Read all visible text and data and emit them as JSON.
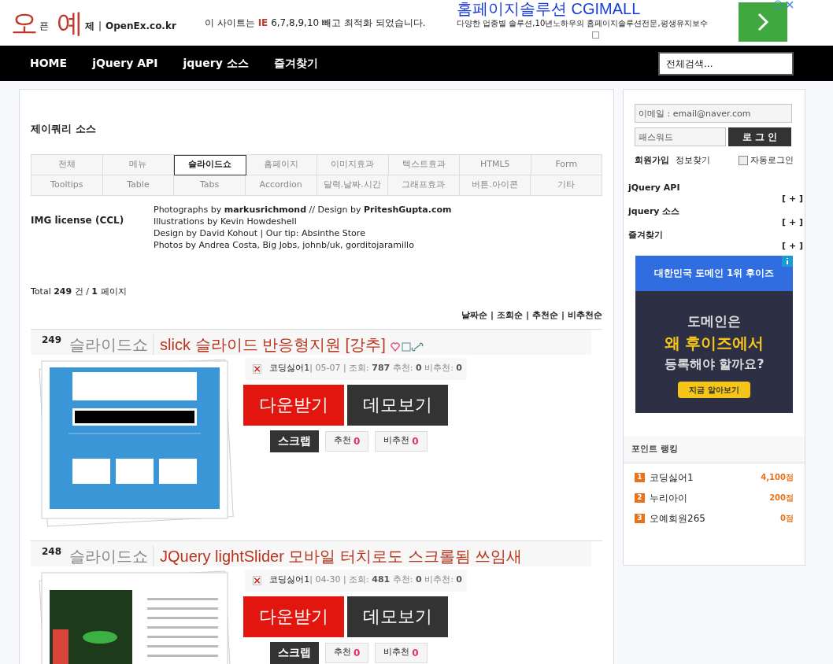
{
  "header": {
    "logo": {
      "big_1": "오",
      "small_1": "픈",
      "big_2": "예",
      "small_2": "제",
      "separator": "|",
      "domain": "OpenEx.co.kr"
    },
    "notice": "이 사이트는 **IE** 6,7,8,9,10 빼고 최적화 되었습니다.",
    "ad": {
      "title": "홈페이지솔루션 CGIMALL",
      "text": "다양한 업종별 솔루션,10년노하우의 홈페이지솔루션전문,평생유지보수",
      "checked": false
    }
  },
  "nav": {
    "items": [
      "HOME",
      "jQuery API",
      "jquery 소스",
      "즐겨찾기"
    ],
    "search": {
      "placeholder": "전체검색..."
    }
  },
  "main": {
    "title": "제이쿼리 소스",
    "categories": [
      {
        "label": "전체",
        "selected": false
      },
      {
        "label": "메뉴",
        "selected": false
      },
      {
        "label": "슬라이드쇼",
        "selected": true
      },
      {
        "label": "홈페이지",
        "selected": false
      },
      {
        "label": "이미지효과",
        "selected": false
      },
      {
        "label": "텍스트효과",
        "selected": false
      },
      {
        "label": "HTML5",
        "selected": false
      },
      {
        "label": "Form",
        "selected": false
      },
      {
        "label": "Tooltips",
        "selected": false
      },
      {
        "label": "Table",
        "selected": false
      },
      {
        "label": "Tabs",
        "selected": false
      },
      {
        "label": "Accordion",
        "selected": false
      },
      {
        "label": "달력.날짜.시간",
        "selected": false
      },
      {
        "label": "그래프효과",
        "selected": false
      },
      {
        "label": "버튼.아이콘",
        "selected": false
      },
      {
        "label": "기타",
        "selected": false
      }
    ],
    "license": {
      "label": "IMG license (CCL)",
      "lines": [
        "Photographs by **markusrichmond** // Design by **PriteshGupta.com**",
        "Illustrations by Kevin Howdeshell",
        "Design by David Kohout | Our tip: Absinthe Store",
        "Photos by Andrea Costa, Big Jobs, johnb/uk, gorditojaramillo"
      ]
    },
    "total": "Total **249** 건 / **1** 페이지",
    "sort": [
      "날짜순",
      "조회순",
      "추천순",
      "비추천순"
    ],
    "sort_separator": "|",
    "posts": [
      {
        "number": "249",
        "category": "슬라이드쇼",
        "title": "slick 슬라이드 반응형지원 [강추]",
        "kind": "slider",
        "author": "코딩싫어1",
        "meta": "| 05-07 | 조회: **787** 추천: **0** 비추천: **0**",
        "download": "다운받기",
        "demo": "데모보기",
        "scrap": "스크랩",
        "up_label": "추천",
        "up_count": "0",
        "down_label": "비추천",
        "down_count": "0",
        "icons": true
      },
      {
        "number": "248",
        "category": "슬라이드쇼",
        "title": "JQuery lightSlider 모바일 터치로도 스크롤됨 쓰임새",
        "kind": "photo",
        "author": "코딩싫어1",
        "meta": "| 04-30 | 조회: **481** 추천: **0** 비추천: **0**",
        "download": "다운받기",
        "demo": "데모보기",
        "scrap": "스크랩",
        "up_label": "추천",
        "up_count": "0",
        "down_label": "비추천",
        "down_count": "0",
        "icons": false
      }
    ]
  },
  "sidebar": {
    "login": {
      "email_placeholder": "이메일 : email@naver.com",
      "password_placeholder": "패스워드",
      "button": "로 그 인",
      "join": "회원가입",
      "find": "정보찾기",
      "auto_login": {
        "label": "자동로그인",
        "checked": false
      }
    },
    "menu": [
      {
        "label": "jQuery API",
        "toggle": "[ + ]"
      },
      {
        "label": "jquery 소스",
        "toggle": "[ + ]"
      },
      {
        "label": "즐겨찾기",
        "toggle": "[ + ]"
      }
    ],
    "ad": {
      "top": "대한민국 도메인 1위 후이즈",
      "line_1": "도메인은",
      "line_2": "왜 후이즈에서",
      "line_3": "등록해야 할까요?",
      "button": "지금 알아보기"
    },
    "ranking": {
      "title": "포인트 랭킹",
      "items": [
        {
          "rank": "1",
          "name": "코딩싫어1",
          "points": "4,100점"
        },
        {
          "rank": "2",
          "name": "누리아이",
          "points": "200점"
        },
        {
          "rank": "3",
          "name": "오예회원265",
          "points": "0점"
        }
      ]
    }
  }
}
